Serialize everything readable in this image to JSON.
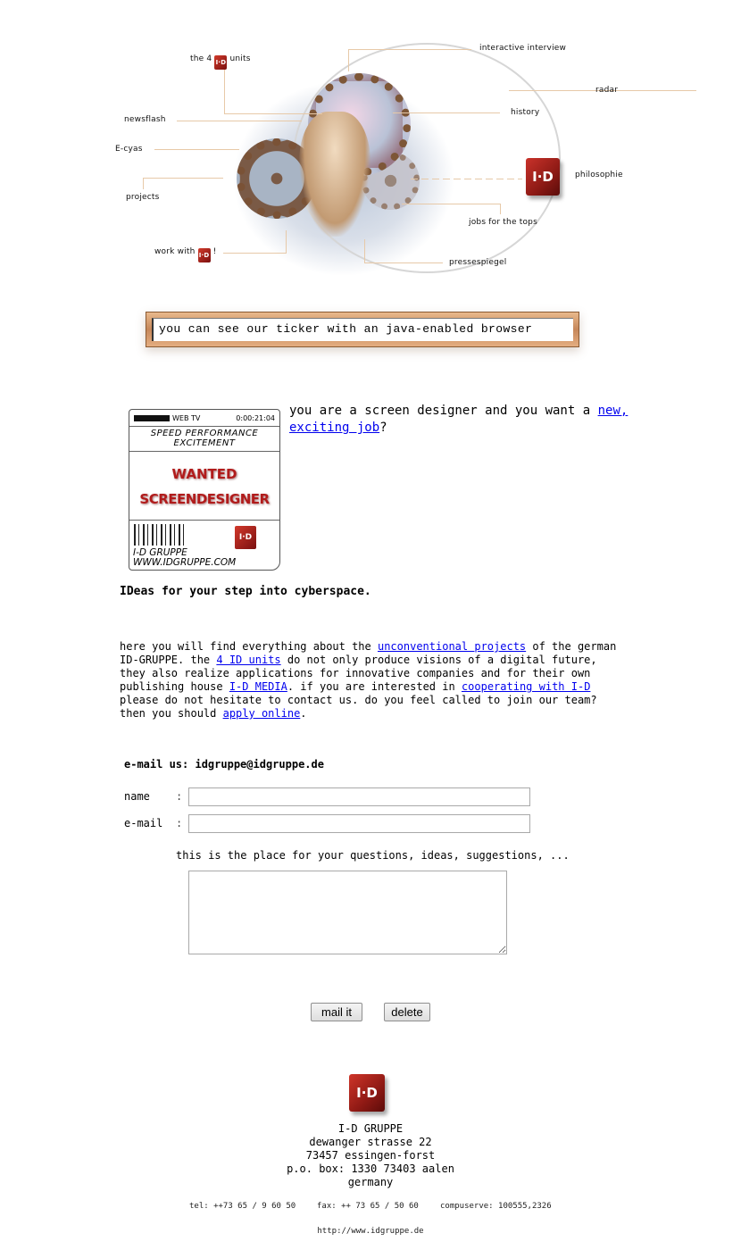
{
  "nav_map": {
    "units": {
      "prefix": "the 4",
      "suffix": "units",
      "logo": "I·D"
    },
    "interactive_interview": "interactive  interview",
    "radar": "radar",
    "history": "history",
    "newsflash": "newsflash",
    "ecyas": "E-cyas",
    "projects": "projects",
    "philosophie": "philosophie",
    "jobs": "jobs for the tops",
    "work_with": {
      "prefix": "work with",
      "suffix": "!",
      "logo": "I·D"
    },
    "pressespiegel": "pressespiegel",
    "cube_logo": "I·D"
  },
  "ticker": {
    "text": "you can see our ticker with an java-enabled browser"
  },
  "wanted_banner": {
    "top_left": "WEB TV",
    "top_right": "0:00:21:04",
    "slogan_line1": "SPEED PERFORMANCE",
    "slogan_line2": "EXCITEMENT",
    "title1": "WANTED",
    "title2": "SCREENDESIGNER",
    "footer1": "I-D GRUPPE",
    "footer2": "WWW.IDGRUPPE.COM",
    "logo": "I·D"
  },
  "job_offer": {
    "text": "you are a screen designer and you want a",
    "link": "new, exciting job",
    "suffix": "?"
  },
  "tagline": "IDeas for your step into cyberspace.",
  "intro": {
    "t1": "here you will find everything about the ",
    "l1": "unconventional projects",
    "t2": " of the german ID-GRUPPE. the ",
    "l2": "4 ID units",
    "t3": " do not only produce visions of a digital future, they also realize applications for innovative companies and for their own publishing house ",
    "l3": "I-D MEDIA",
    "t4": ". if you are interested in ",
    "l4": "cooperating with I-D",
    "t5": " please do not hesitate to contact us. do you feel called to join our team? then you should ",
    "l5": "apply online",
    "t6": "."
  },
  "form": {
    "email_us": "e-mail us: idgruppe@idgruppe.de",
    "name_label": "name",
    "email_label": "e-mail",
    "colon": ":",
    "name_value": "",
    "email_value": "",
    "message_label": "this is the place for your questions, ideas, suggestions, ...",
    "message_value": "",
    "submit_label": "mail it",
    "reset_label": "delete"
  },
  "footer": {
    "logo": "I·D",
    "company": "I-D GRUPPE",
    "street": "dewanger strasse 22",
    "city": "73457 essingen-forst",
    "pobox": "p.o. box: 1330 73403 aalen",
    "country": "germany",
    "tel": "tel: ++73 65 / 9 60 50",
    "fax": "fax: ++ 73 65 / 50 60",
    "compuserve": "compuserve: 100555,2326",
    "url": "http://www.idgruppe.de"
  }
}
